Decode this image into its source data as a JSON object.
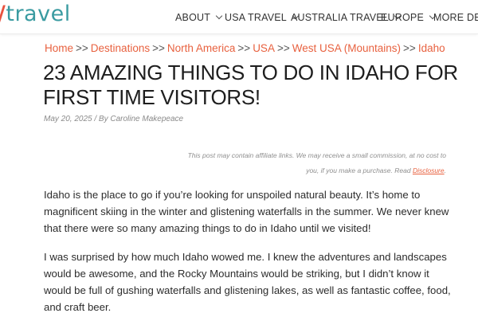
{
  "header": {
    "logo_mark": "/",
    "logo_word": "travel",
    "nav": [
      {
        "label": "ABOUT"
      },
      {
        "label": "USA TRAVEL"
      },
      {
        "label": "AUSTRALIA TRAVEL"
      },
      {
        "label": "EUROPE"
      },
      {
        "label": "MORE DESTIN"
      }
    ]
  },
  "breadcrumb": {
    "items": [
      "Home",
      "Destinations",
      "North America",
      "USA",
      "West USA (Mountains)",
      "Idaho"
    ],
    "separator": ">>"
  },
  "article": {
    "title": "23 Amazing Things to Do in Idaho for First Time Visitors!",
    "meta": "May 20, 2025 / By Caroline Makepeace",
    "disclaimer_text": "This post may contain affiliate links. We may receive a small commission, at no cost to you, if you make a purchase. Read",
    "disclaimer_link": "Disclosure",
    "disclaimer_end": ".",
    "paragraphs": [
      "Idaho is the place to go if you’re looking for unspoiled natural beauty. It’s home to magnificent skiing in the winter and glistening waterfalls in the summer. We never knew that there were so many amazing things to do in Idaho until we visited!",
      "I was surprised by how much Idaho wowed me. I knew the adventures and landscapes would be awesome, and the Rocky Mountains would be striking, but I didn’t know it would be full of gushing waterfalls and glistening lakes, as well as fantastic coffee, food, and craft beer."
    ]
  },
  "colors": {
    "accent_link": "#e8613f",
    "logo_teal": "#3a9ba1",
    "logo_red": "#e8523f"
  }
}
